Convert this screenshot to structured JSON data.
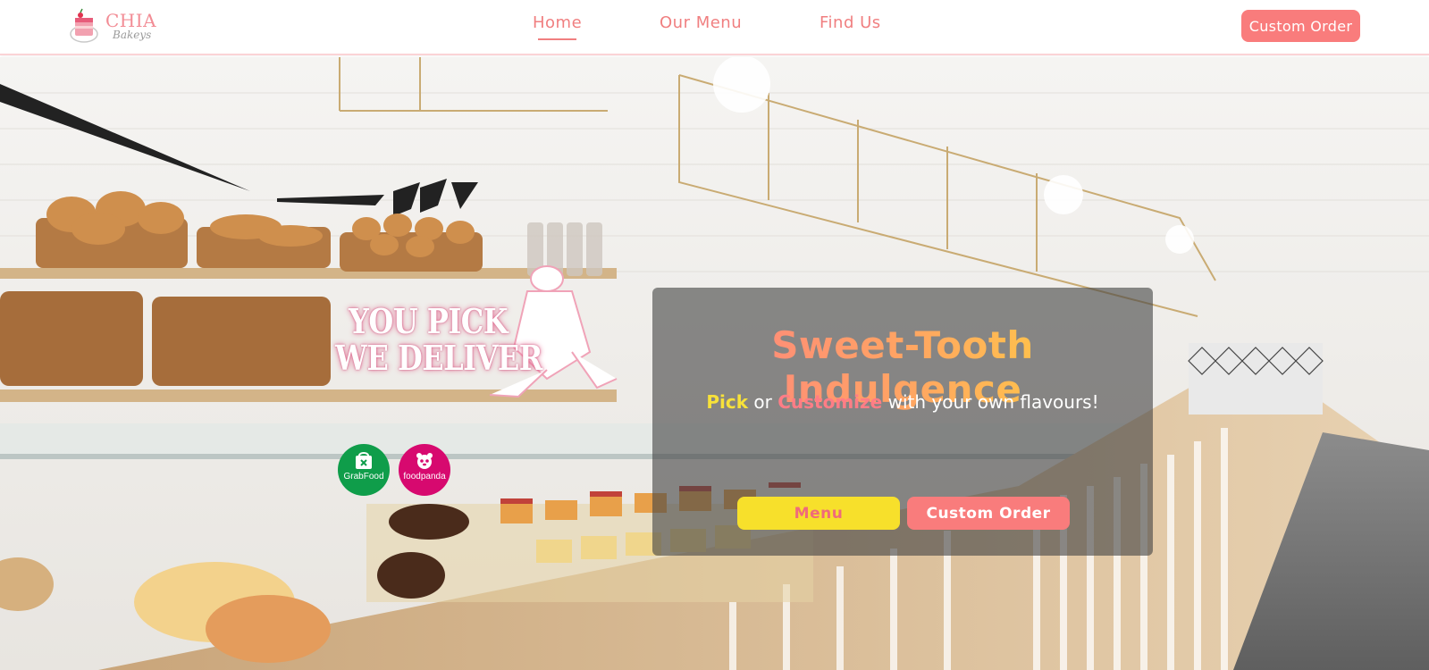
{
  "brand": {
    "name": "CHIA",
    "tagline": "Bakeys"
  },
  "nav": {
    "links": [
      {
        "label": "Home",
        "active": true
      },
      {
        "label": "Our Menu",
        "active": false
      },
      {
        "label": "Find Us",
        "active": false
      }
    ],
    "cta_label": "Custom Order"
  },
  "hero": {
    "promo": {
      "line1": "YOU PICK",
      "line2": "WE DELIVER",
      "badges": [
        {
          "label": "GrabFood",
          "icon": "grabfood-icon",
          "color": "#0f9d4a"
        },
        {
          "label": "foodpanda",
          "icon": "foodpanda-icon",
          "color": "#d7096f"
        }
      ]
    },
    "card": {
      "headline": "Sweet-Tooth Indulgence",
      "tagline_parts": [
        "Pick",
        " or ",
        "Customize",
        " with your own flavours!"
      ],
      "buttons": {
        "menu_label": "Menu",
        "custom_label": "Custom Order"
      }
    }
  },
  "colors": {
    "accent": "#f07f80",
    "cta": "#f97c7c",
    "yellow": "#f7e02b",
    "nav_border": "#fbd3d6"
  }
}
